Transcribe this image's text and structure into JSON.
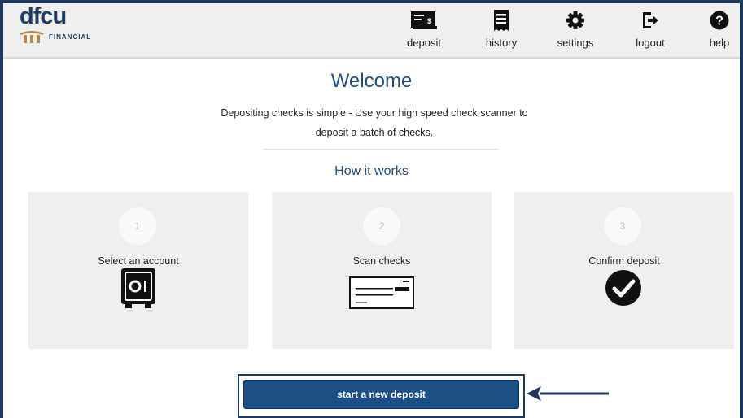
{
  "brand": {
    "logo_text": "dfcu",
    "logo_subtext": "FINANCIAL",
    "primary_color": "#1f3b63",
    "accent_color": "#b5894b"
  },
  "nav": {
    "items": [
      {
        "label": "deposit",
        "icon": "check-deposit-icon"
      },
      {
        "label": "history",
        "icon": "receipt-icon"
      },
      {
        "label": "settings",
        "icon": "gear-icon"
      },
      {
        "label": "logout",
        "icon": "logout-icon"
      },
      {
        "label": "help",
        "icon": "question-icon"
      }
    ]
  },
  "main": {
    "title": "Welcome",
    "description_line1": "Depositing checks is simple - Use your high speed check scanner to",
    "description_line2": "deposit a batch of checks.",
    "how_it_works": "How it works",
    "steps": [
      {
        "number": "1",
        "label": "Select an account",
        "icon": "safe-icon"
      },
      {
        "number": "2",
        "label": "Scan checks",
        "icon": "check-icon"
      },
      {
        "number": "3",
        "label": "Confirm deposit",
        "icon": "checkmark-circle-icon"
      }
    ],
    "start_button": "start a new deposit",
    "button_color": "#1b4f86"
  }
}
